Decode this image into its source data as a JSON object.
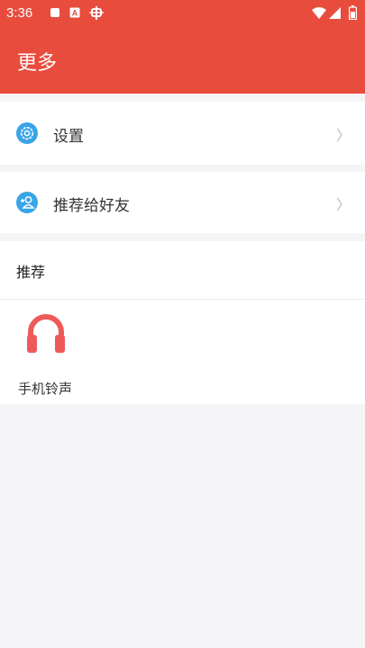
{
  "status_bar": {
    "time": "3:36",
    "icons": [
      "notification-square-icon",
      "a-app-icon",
      "bug-icon",
      "wifi-icon",
      "signal-icon",
      "battery-icon"
    ]
  },
  "header": {
    "title": "更多",
    "color": "#e84c3d"
  },
  "menu": [
    {
      "label": "设置",
      "icon": "gear-icon",
      "icon_color": "#3aa4e8"
    },
    {
      "label": "推荐给好友",
      "icon": "add-user-icon",
      "icon_color": "#3aa4e8"
    }
  ],
  "recommend": {
    "title": "推荐",
    "items": [
      {
        "label": "手机铃声",
        "icon": "headphones-icon",
        "icon_color": "#ee5a5a"
      }
    ]
  }
}
